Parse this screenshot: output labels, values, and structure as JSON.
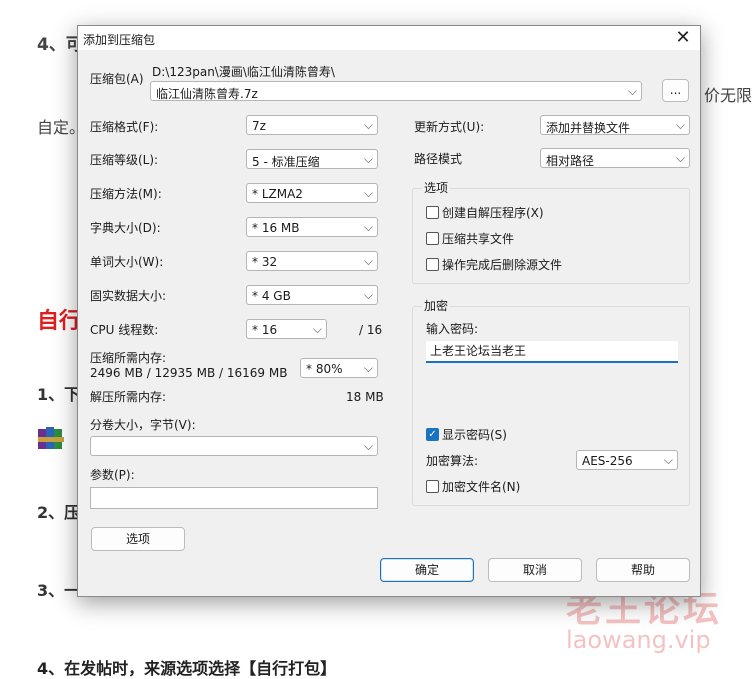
{
  "background": {
    "line1": "4、可",
    "line2": "自定。",
    "line2_right": "价无限",
    "heading": "自行",
    "item1": "1、下",
    "item2": "2、压",
    "item3": "3、一",
    "footer": "4、在发帖时，来源选项选择【自行打包】",
    "watermark_title": "老王论坛",
    "watermark_url": "laowang.vip"
  },
  "dialog": {
    "title": "添加到压缩包",
    "archive": {
      "label": "压缩包(A)",
      "path": "D:\\123pan\\漫画\\临江仙清陈曾寿\\",
      "filename": "临江仙清陈曾寿.7z",
      "browse_label": "..."
    },
    "left": {
      "format_label": "压缩格式(F):",
      "format_value": "7z",
      "level_label": "压缩等级(L):",
      "level_value": "5 - 标准压缩",
      "method_label": "压缩方法(M):",
      "method_value": "* LZMA2",
      "dict_label": "字典大小(D):",
      "dict_value": "* 16 MB",
      "word_label": "单词大小(W):",
      "word_value": "* 32",
      "solid_label": "固实数据大小:",
      "solid_value": "* 4 GB",
      "threads_label": "CPU 线程数:",
      "threads_value": "* 16",
      "threads_max": "/ 16",
      "mem_label": "压缩所需内存:",
      "mem_detail": "2496 MB / 12935 MB / 16169 MB",
      "mem_pct": "* 80%",
      "decomp_label": "解压所需内存:",
      "decomp_value": "18 MB",
      "split_label": "分卷大小，字节(V):",
      "split_value": "",
      "params_label": "参数(P):",
      "params_value": "",
      "options_button": "选项"
    },
    "right": {
      "update_label": "更新方式(U):",
      "update_value": "添加并替换文件",
      "path_label": "路径模式",
      "path_value": "相对路径",
      "options_title": "选项",
      "opt_sfx": "创建自解压程序(X)",
      "opt_shared": "压缩共享文件",
      "opt_delete": "操作完成后删除源文件",
      "enc_title": "加密",
      "password_label": "输入密码:",
      "password_value": "上老王论坛当老王",
      "show_password": "显示密码(S)",
      "enc_method_label": "加密算法:",
      "enc_method_value": "AES-256",
      "enc_names": "加密文件名(N)"
    },
    "buttons": {
      "ok": "确定",
      "cancel": "取消",
      "help": "帮助"
    }
  },
  "colors": {
    "accent": "#1a73c0",
    "red": "#e01e1e",
    "green": "#2e8b3e"
  }
}
